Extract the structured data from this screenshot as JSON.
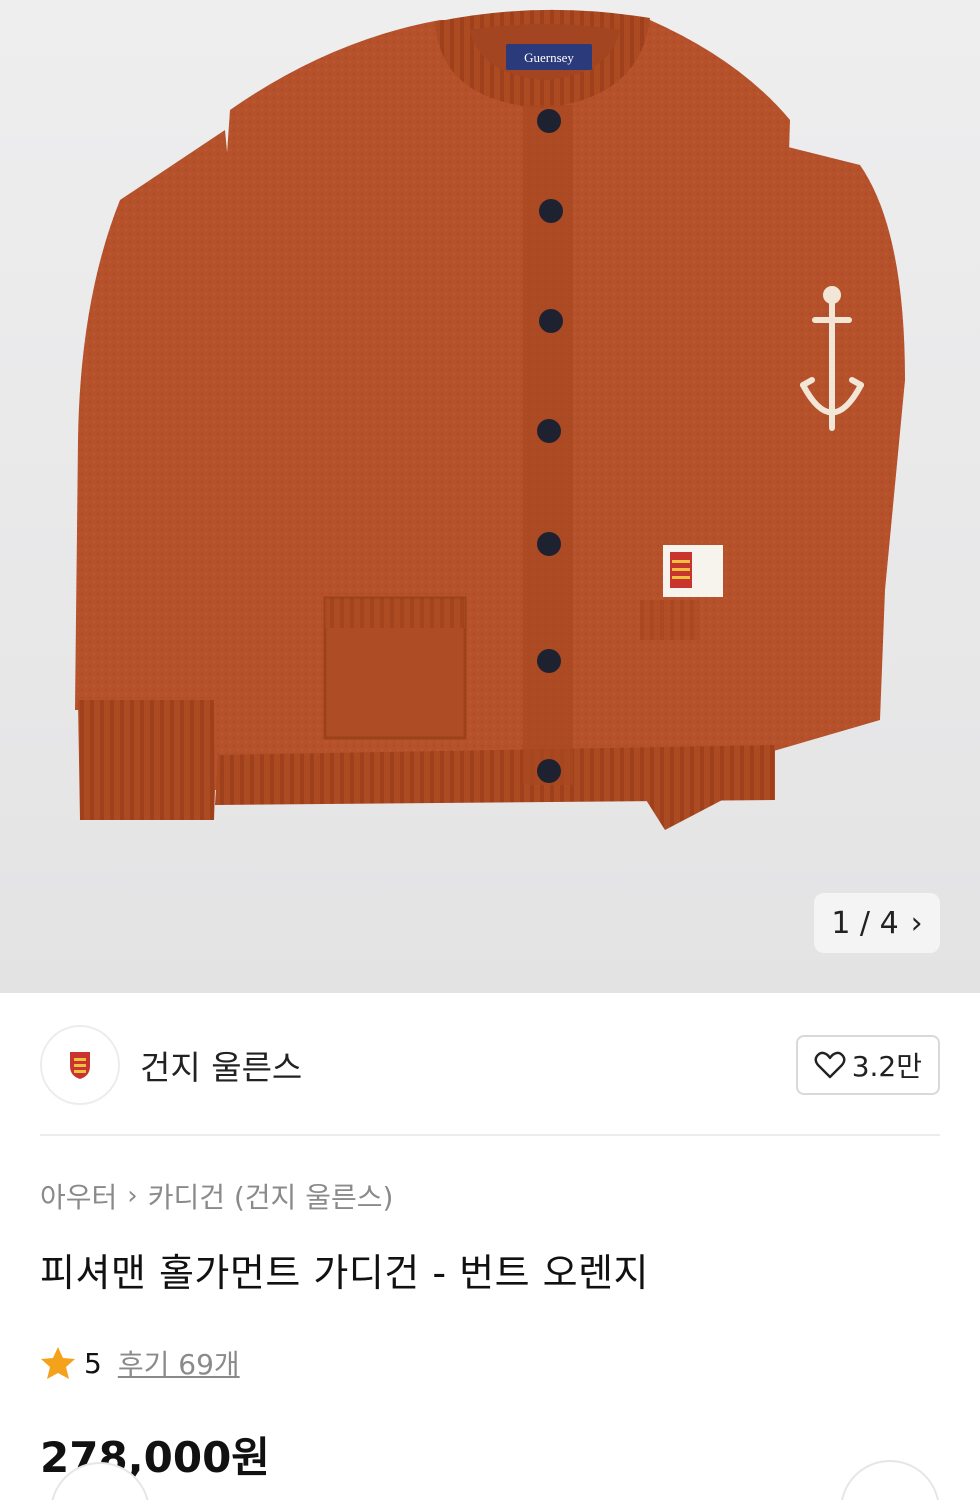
{
  "gallery": {
    "label_text": "Guernsey",
    "counter": "1 / 4",
    "next_icon": "chevron-right-icon"
  },
  "brand": {
    "name": "건지 울른스",
    "logo_icon": "shield-crest-icon",
    "like_count": "3.2만",
    "like_icon": "heart-outline-icon"
  },
  "breadcrumb": {
    "items": [
      "아우터",
      "카디건 (건지 울른스)"
    ],
    "separator_icon": "chevron-right-icon"
  },
  "product": {
    "title": "피셔맨 홀가먼트 가디건 - 번트 오렌지",
    "rating": "5",
    "reviews": "후기 69개",
    "price": "278,000원"
  },
  "colors": {
    "sweater": "#b5512b",
    "accent_star": "#f4a21b"
  }
}
